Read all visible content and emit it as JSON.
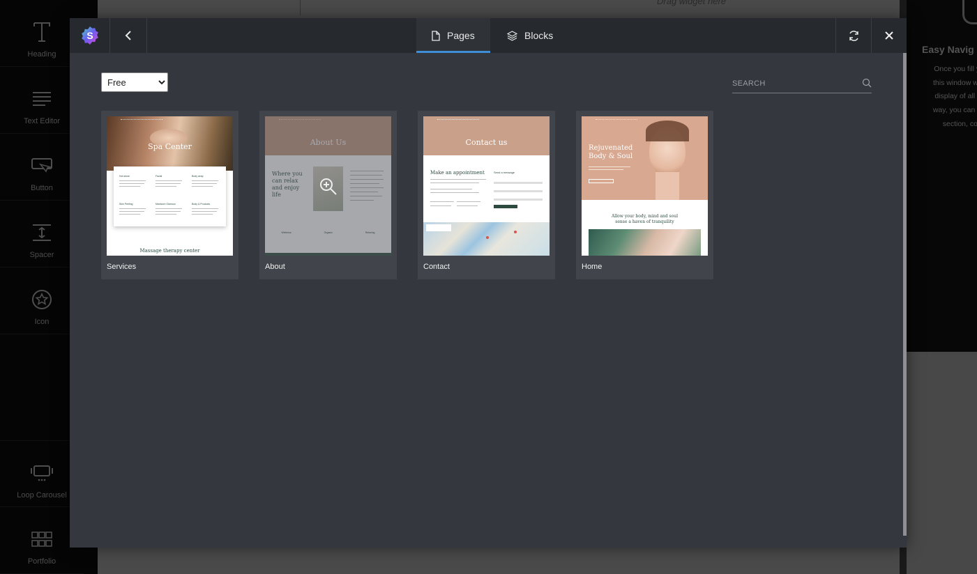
{
  "background": {
    "drag_hint": "Drag widget here",
    "widgets": [
      {
        "label": "Heading",
        "icon": "heading-icon"
      },
      {
        "label": "Text Editor",
        "icon": "text-editor-icon"
      },
      {
        "label": "Button",
        "icon": "button-icon"
      },
      {
        "label": "Spacer",
        "icon": "spacer-icon"
      },
      {
        "label": "Icon",
        "icon": "star-icon"
      },
      {
        "label": "Loop Carousel",
        "icon": "carousel-icon"
      },
      {
        "label": "Portfolio",
        "icon": "grid-icon"
      }
    ],
    "right_panel": {
      "title": "Easy Navig",
      "lines": [
        "Once you fill you",
        "this window will c",
        "display of all the",
        "way, you can eas",
        "section, col"
      ]
    }
  },
  "modal": {
    "tabs": [
      {
        "label": "Pages",
        "icon": "page-icon",
        "active": true
      },
      {
        "label": "Blocks",
        "icon": "layers-icon",
        "active": false
      }
    ],
    "filter": {
      "selected": "Free",
      "options": [
        "Free"
      ]
    },
    "search": {
      "placeholder": "SEARCH"
    },
    "accent_color": "#3d8ed6",
    "templates": [
      {
        "label": "Services",
        "hero_title": "Spa Center",
        "footer_text": "Massage therapy center",
        "items": [
          "Hot stone",
          "Facial",
          "Body wrap",
          "Skin Peeling",
          "Manicure Glamour",
          "Body & Products"
        ]
      },
      {
        "label": "About",
        "hero_title": "About Us",
        "headline": "Where you can relax and enjoy life",
        "features": [
          "Wellness",
          "Organic",
          "Relaxing"
        ]
      },
      {
        "label": "Contact",
        "hero_title": "Contact us",
        "headline": "Make an appointment",
        "form_title": "Send a message"
      },
      {
        "label": "Home",
        "hero_title": "Rejuvenated Body & Soul",
        "subheadline": "Allow your body, mind and soul sense a haven of tranquility"
      }
    ]
  }
}
